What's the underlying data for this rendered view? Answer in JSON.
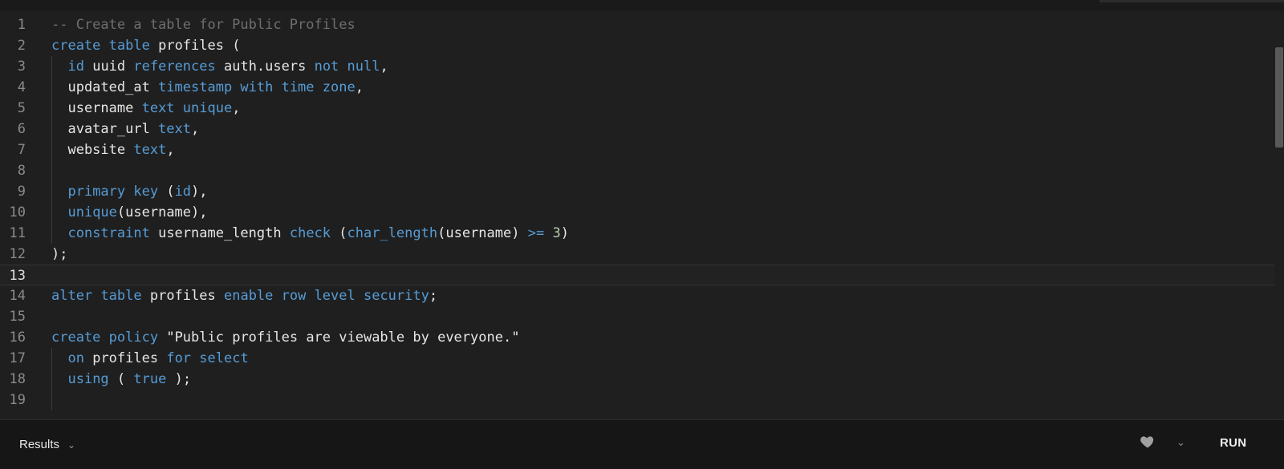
{
  "editor": {
    "current_line": 13,
    "lines": [
      {
        "n": "1",
        "tokens": [
          {
            "c": "cm",
            "t": "-- Create a table for Public Profiles"
          }
        ]
      },
      {
        "n": "2",
        "tokens": [
          {
            "c": "kw",
            "t": "create"
          },
          {
            "t": " "
          },
          {
            "c": "kw",
            "t": "table"
          },
          {
            "t": " profiles ("
          }
        ]
      },
      {
        "n": "3",
        "tokens": [
          {
            "t": "  "
          },
          {
            "c": "kw",
            "t": "id"
          },
          {
            "t": " uuid "
          },
          {
            "c": "kw",
            "t": "references"
          },
          {
            "t": " auth.users "
          },
          {
            "c": "kw",
            "t": "not null"
          },
          {
            "t": ","
          }
        ]
      },
      {
        "n": "4",
        "tokens": [
          {
            "t": "  updated_at "
          },
          {
            "c": "kw",
            "t": "timestamp with time zone"
          },
          {
            "t": ","
          }
        ]
      },
      {
        "n": "5",
        "tokens": [
          {
            "t": "  username "
          },
          {
            "c": "kw",
            "t": "text unique"
          },
          {
            "t": ","
          }
        ]
      },
      {
        "n": "6",
        "tokens": [
          {
            "t": "  avatar_url "
          },
          {
            "c": "kw",
            "t": "text"
          },
          {
            "t": ","
          }
        ]
      },
      {
        "n": "7",
        "tokens": [
          {
            "t": "  website "
          },
          {
            "c": "kw",
            "t": "text"
          },
          {
            "t": ","
          }
        ]
      },
      {
        "n": "8",
        "tokens": [
          {
            "t": ""
          }
        ]
      },
      {
        "n": "9",
        "tokens": [
          {
            "t": "  "
          },
          {
            "c": "kw",
            "t": "primary key"
          },
          {
            "t": " ("
          },
          {
            "c": "kw",
            "t": "id"
          },
          {
            "t": "),"
          }
        ]
      },
      {
        "n": "10",
        "tokens": [
          {
            "t": "  "
          },
          {
            "c": "kw",
            "t": "unique"
          },
          {
            "t": "(username),"
          }
        ]
      },
      {
        "n": "11",
        "tokens": [
          {
            "t": "  "
          },
          {
            "c": "kw",
            "t": "constraint"
          },
          {
            "t": " username_length "
          },
          {
            "c": "kw",
            "t": "check"
          },
          {
            "t": " ("
          },
          {
            "c": "kw",
            "t": "char_length"
          },
          {
            "t": "(username) "
          },
          {
            "c": "kw",
            "t": ">="
          },
          {
            "t": " "
          },
          {
            "c": "num",
            "t": "3"
          },
          {
            "t": ")"
          }
        ]
      },
      {
        "n": "12",
        "tokens": [
          {
            "t": ");"
          }
        ]
      },
      {
        "n": "13",
        "tokens": [
          {
            "t": ""
          }
        ]
      },
      {
        "n": "14",
        "tokens": [
          {
            "c": "kw",
            "t": "alter"
          },
          {
            "t": " "
          },
          {
            "c": "kw",
            "t": "table"
          },
          {
            "t": " profiles "
          },
          {
            "c": "kw",
            "t": "enable row level security"
          },
          {
            "t": ";"
          }
        ]
      },
      {
        "n": "15",
        "tokens": [
          {
            "t": ""
          }
        ]
      },
      {
        "n": "16",
        "tokens": [
          {
            "c": "kw",
            "t": "create"
          },
          {
            "t": " "
          },
          {
            "c": "kw",
            "t": "policy"
          },
          {
            "t": " \"Public profiles are viewable by everyone.\""
          }
        ]
      },
      {
        "n": "17",
        "tokens": [
          {
            "t": "  "
          },
          {
            "c": "kw",
            "t": "on"
          },
          {
            "t": " profiles "
          },
          {
            "c": "kw",
            "t": "for select"
          }
        ]
      },
      {
        "n": "18",
        "tokens": [
          {
            "t": "  "
          },
          {
            "c": "kw",
            "t": "using"
          },
          {
            "t": " ( "
          },
          {
            "c": "kw",
            "t": "true"
          },
          {
            "t": " );"
          }
        ]
      },
      {
        "n": "19",
        "tokens": [
          {
            "t": ""
          }
        ]
      }
    ]
  },
  "bottombar": {
    "results_label": "Results",
    "run_label": "RUN",
    "favorite_icon": "heart-icon",
    "dropdown_icon": "chevron-down-icon"
  },
  "colors": {
    "background": "#1f1f1f",
    "keyword": "#569cd6",
    "comment": "#6e6e6e",
    "text": "#e6e6e6"
  }
}
